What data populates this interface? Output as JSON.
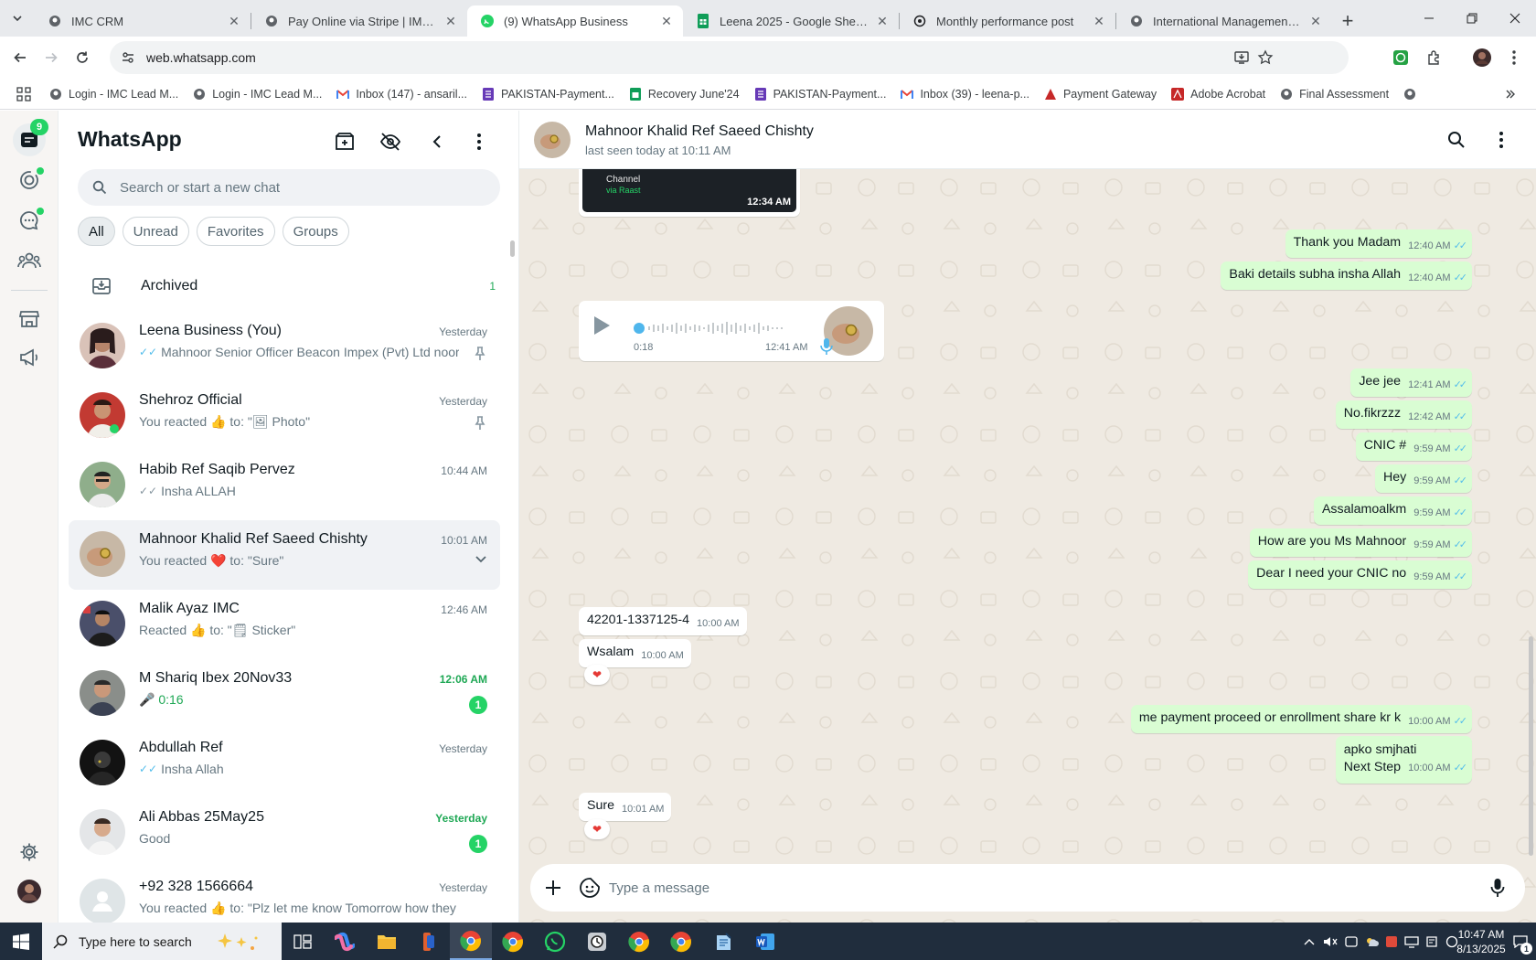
{
  "browser": {
    "tabs": [
      {
        "title": "IMC CRM",
        "active": false
      },
      {
        "title": "Pay Online via Stripe | IMC Certi",
        "active": false
      },
      {
        "title": "(9) WhatsApp Business",
        "active": true
      },
      {
        "title": "Leena 2025 - Google Sheets",
        "active": false
      },
      {
        "title": "Monthly performance post",
        "active": false
      },
      {
        "title": "International Management Con",
        "active": false
      }
    ],
    "url": "web.whatsapp.com",
    "bookmarks": [
      {
        "label": "Login - IMC Lead M...",
        "icon": "imc-icon"
      },
      {
        "label": "Login - IMC Lead M...",
        "icon": "imc-icon"
      },
      {
        "label": "Inbox (147) - ansaril...",
        "icon": "gmail-icon"
      },
      {
        "label": "PAKISTAN-Payment...",
        "icon": "forms-icon"
      },
      {
        "label": "Recovery June'24",
        "icon": "sheets-icon"
      },
      {
        "label": "PAKISTAN-Payment...",
        "icon": "forms-icon"
      },
      {
        "label": "Inbox (39) - leena-p...",
        "icon": "gmail-icon"
      },
      {
        "label": "Payment Gateway",
        "icon": "acrobat-icon"
      },
      {
        "label": "Adobe Acrobat",
        "icon": "acrobat-icon"
      },
      {
        "label": "Final Assessment",
        "icon": "imc-icon"
      }
    ]
  },
  "whatsapp": {
    "unread_badge": "9",
    "brand": "WhatsApp",
    "search_placeholder": "Search or start a new chat",
    "filters": [
      "All",
      "Unread",
      "Favorites",
      "Groups"
    ],
    "archived": {
      "label": "Archived",
      "count": "1"
    },
    "chats": [
      {
        "name": "Leena Business (You)",
        "time": "Yesterday",
        "preview": "Mahnoor Senior Officer Beacon Impex (Pvt) Ltd noor...",
        "tick": "blue",
        "pinned": true
      },
      {
        "name": "Shehroz Official",
        "time": "Yesterday",
        "preview": "You reacted 👍 to: \"🖼 Photo\"",
        "tick": "",
        "pinned": true
      },
      {
        "name": "Habib Ref Saqib Pervez",
        "time": "10:44 AM",
        "preview": "Insha ALLAH",
        "tick": "grey"
      },
      {
        "name": "Mahnoor Khalid Ref Saeed Chishty",
        "time": "10:01 AM",
        "preview": "You reacted ❤️ to: \"Sure\"",
        "tick": "",
        "selected": true
      },
      {
        "name": "Malik Ayaz IMC",
        "time": "12:46 AM",
        "preview": "Reacted 👍 to: \"🗒 Sticker\"",
        "tick": ""
      },
      {
        "name": "M Shariq Ibex 20Nov33",
        "time": "12:06 AM",
        "preview": "🎤 0:16",
        "tick": "",
        "unread": "1"
      },
      {
        "name": "Abdullah Ref",
        "time": "Yesterday",
        "preview": "Insha Allah",
        "tick": "blue"
      },
      {
        "name": "Ali Abbas 25May25",
        "time": "Yesterday",
        "preview": "Good",
        "tick": "",
        "unread": "1"
      },
      {
        "name": "+92 328 1566664",
        "time": "Yesterday",
        "preview": "You reacted 👍 to: \"Plz let me know Tomorrow how they w...",
        "tick": ""
      }
    ],
    "conversation": {
      "name": "Mahnoor Khalid Ref Saeed Chishty",
      "status": "last seen today at 10:11 AM",
      "channel_card": {
        "label": "Channel",
        "sub": "via Raast",
        "time": "12:34 AM"
      },
      "voice_note": {
        "duration": "0:18",
        "time": "12:41 AM"
      },
      "messages": [
        {
          "dir": "out",
          "text": "Thank you Madam",
          "time": "12:40 AM"
        },
        {
          "dir": "out",
          "text": "Baki details subha insha Allah",
          "time": "12:40 AM"
        },
        {
          "dir": "out",
          "text": "Jee jee",
          "time": "12:41 AM"
        },
        {
          "dir": "out",
          "text": "No.fikrzzz",
          "time": "12:42 AM"
        },
        {
          "dir": "out",
          "text": "CNIC #",
          "time": "9:59 AM"
        },
        {
          "dir": "out",
          "text": "Hey",
          "time": "9:59 AM"
        },
        {
          "dir": "out",
          "text": "Assalamoalkm",
          "time": "9:59 AM"
        },
        {
          "dir": "out",
          "text": "How are you Ms Mahnoor",
          "time": "9:59 AM"
        },
        {
          "dir": "out",
          "text": "Dear I need your CNIC no",
          "time": "9:59 AM"
        },
        {
          "dir": "in",
          "text": "42201-1337125-4",
          "time": "10:00 AM"
        },
        {
          "dir": "in",
          "text": "Wsalam",
          "time": "10:00 AM",
          "reaction": "❤"
        },
        {
          "dir": "out",
          "text": "me payment proceed or enrollment share kr k",
          "time": "10:00 AM"
        },
        {
          "dir": "out",
          "text": "apko smjhati",
          "text2": "Next Step",
          "time": "10:00 AM"
        },
        {
          "dir": "in",
          "text": "Sure",
          "time": "10:01 AM",
          "reaction": "❤"
        }
      ],
      "composer_placeholder": "Type a message"
    }
  },
  "taskbar": {
    "search_placeholder": "Type here to search",
    "time": "10:47 AM",
    "date": "8/13/2025",
    "notifications": "1"
  },
  "colors": {
    "accent_green": "#25d366",
    "outgoing_bubble": "#d9fdd3",
    "chat_bg": "#efeae2",
    "read_tick": "#53bdeb"
  }
}
